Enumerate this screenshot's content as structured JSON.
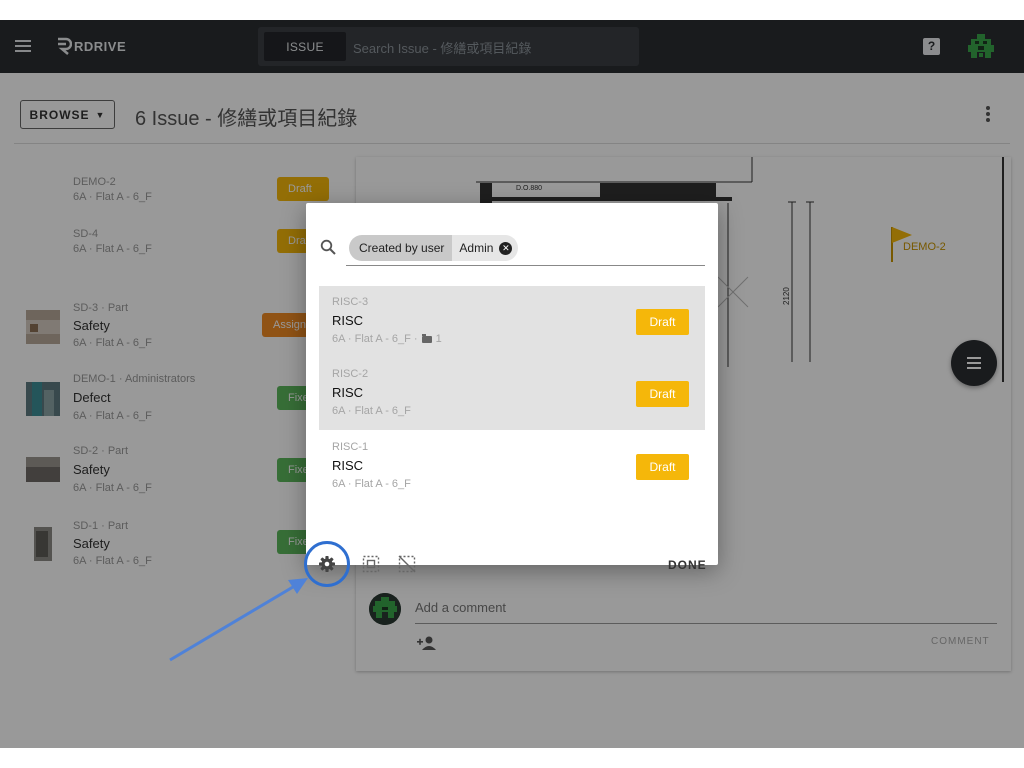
{
  "topbar": {
    "logo_text": "RDRIVE",
    "search_chip": "ISSUE",
    "search_placeholder": "Search Issue - 修繕或項目紀錄",
    "help_glyph": "?"
  },
  "header": {
    "browse_label": "BROWSE",
    "title": "6 Issue - 修繕或項目紀錄"
  },
  "issues": [
    {
      "ref": "DEMO-2",
      "type": "",
      "location": "6A · Flat A - 6_F",
      "status": "Draft",
      "status_color": "#f5b70a"
    },
    {
      "ref": "SD-4",
      "type": "",
      "location": "6A · Flat A - 6_F",
      "status": "Draft",
      "status_color": "#f5b70a"
    },
    {
      "ref": "SD-3 · Part",
      "type": "Safety",
      "location": "6A · Flat A - 6_F",
      "status": "Assigned",
      "status_color": "#f08a24"
    },
    {
      "ref": "DEMO-1 · Administrators",
      "type": "Defect",
      "location": "6A · Flat A - 6_F",
      "status": "Fixed",
      "status_color": "#5cb85c"
    },
    {
      "ref": "SD-2 · Part",
      "type": "Safety",
      "location": "6A · Flat A - 6_F",
      "status": "Fixed",
      "status_color": "#5cb85c"
    },
    {
      "ref": "SD-1 · Part",
      "type": "Safety",
      "location": "6A · Flat A - 6_F",
      "status": "Fixed",
      "status_color": "#5cb85c"
    }
  ],
  "drawing": {
    "label_do": "D.O.880",
    "dimension": "2120",
    "pin_label": "DEMO-2"
  },
  "comment": {
    "placeholder": "Add a comment",
    "button": "COMMENT"
  },
  "dialog": {
    "filter": {
      "label": "Created by user",
      "value": "Admin"
    },
    "results": [
      {
        "ref": "RISC-3",
        "type": "RISC",
        "location": "6A · Flat A - 6_F ·",
        "attachments": "1",
        "status": "Draft",
        "selected": true
      },
      {
        "ref": "RISC-2",
        "type": "RISC",
        "location": "6A · Flat A - 6_F",
        "attachments": "",
        "status": "Draft",
        "selected": true
      },
      {
        "ref": "RISC-1",
        "type": "RISC",
        "location": "6A · Flat A - 6_F",
        "attachments": "",
        "status": "Draft",
        "selected": false
      }
    ],
    "done_label": "DONE"
  },
  "colors": {
    "topbar": "#2a2d31",
    "draft": "#f5b70a",
    "assigned": "#f08a24",
    "fixed": "#5cb85c",
    "annotation": "#2f6fd0"
  },
  "icons": [
    "menu-icon",
    "help-icon",
    "user-avatar-icon",
    "more-vert-icon",
    "search-icon",
    "close-circle-icon",
    "gear-icon",
    "select-all-icon",
    "deselect-icon",
    "folder-icon",
    "add-person-icon",
    "list-fab-icon",
    "flag-pin-icon"
  ]
}
